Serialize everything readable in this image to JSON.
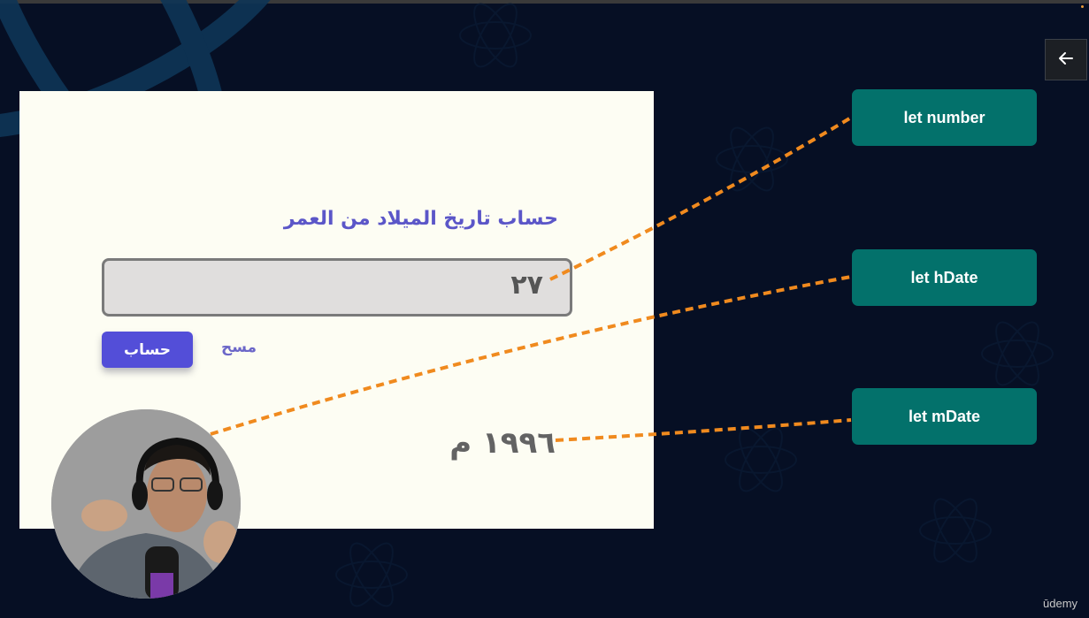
{
  "navigation": {
    "back_icon": "arrow-left-icon"
  },
  "app": {
    "title": "حساب تاريخ الميلاد من العمر",
    "age_input_value": "٢٧",
    "calculate_label": "حساب",
    "clear_label": "مسح",
    "result_text": "١٩٩٦ م"
  },
  "variables": [
    {
      "label": "let number"
    },
    {
      "label": "let hDate"
    },
    {
      "label": "let mDate"
    }
  ],
  "branding": {
    "watermark": "ūdemy"
  },
  "colors": {
    "background": "#060f24",
    "card": "#fdfdf3",
    "accent_purple": "#534ed8",
    "variable_box": "#03716b",
    "connector": "#f08a1e"
  }
}
